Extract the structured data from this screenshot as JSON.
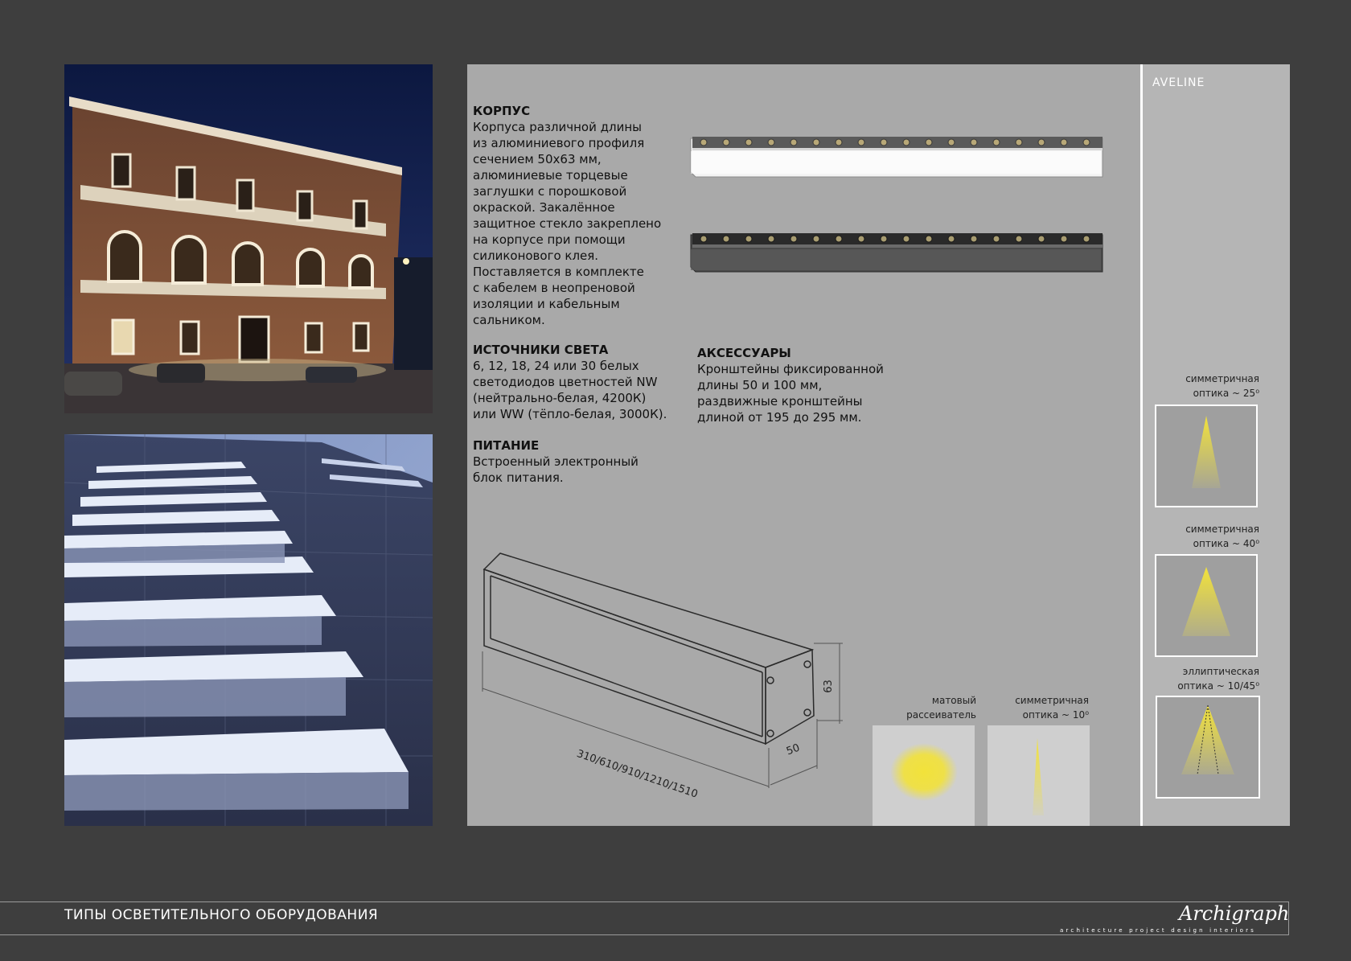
{
  "brand": "AVELINE",
  "sections": {
    "body": {
      "title": "КОРПУС",
      "text": "Корпуса различной длины\nиз алюминиевого профиля\nсечением 50х63 мм,\nалюминиевые торцевые\nзаглушки с порошковой\nокраской. Закалённое\nзащитное стекло закреплено\nна корпусе при помощи\nсиликонового клея.\nПоставляется в комплекте\nс кабелем в неопреновой\nизоляции и кабельным\nсальником."
    },
    "light": {
      "title": "ИСТОЧНИКИ СВЕТА",
      "text": "6, 12, 18, 24 или 30 белых\nсветодиодов цветностей NW\n(нейтрально-белая, 4200К)\nили WW (тёпло-белая, 3000К)."
    },
    "power": {
      "title": "ПИТАНИЕ",
      "text": "Встроенный электронный\nблок питания."
    },
    "accessories": {
      "title": "АКСЕССУАРЫ",
      "text": "Кронштейны фиксированной\nдлины 50 и 100 мм,\nраздвижные кронштейны\nдлиной от 195 до 295 мм."
    }
  },
  "drawing": {
    "length_label": "310/610/910/1210/1510",
    "width_label": "50",
    "height_label": "63"
  },
  "optics": {
    "sym25": "симметричная\nоптика ~ 25⁰",
    "sym40": "симметричная\nоптика ~ 40⁰",
    "ell": "эллиптическая\nоптика ~ 10/45⁰",
    "matte": "матовый\nрассеиватель",
    "sym10": "симметричная\nоптика ~ 10⁰"
  },
  "footer": {
    "title": "ТИПЫ ОСВЕТИТЕЛЬНОГО ОБОРУДОВАНИЯ",
    "logo": "Archigraph",
    "tagline": "architecture   project   design   interiors"
  },
  "colors": {
    "background": "#3e3e3e",
    "panel": "#a9a9a9",
    "beam": "#f2e23a"
  }
}
